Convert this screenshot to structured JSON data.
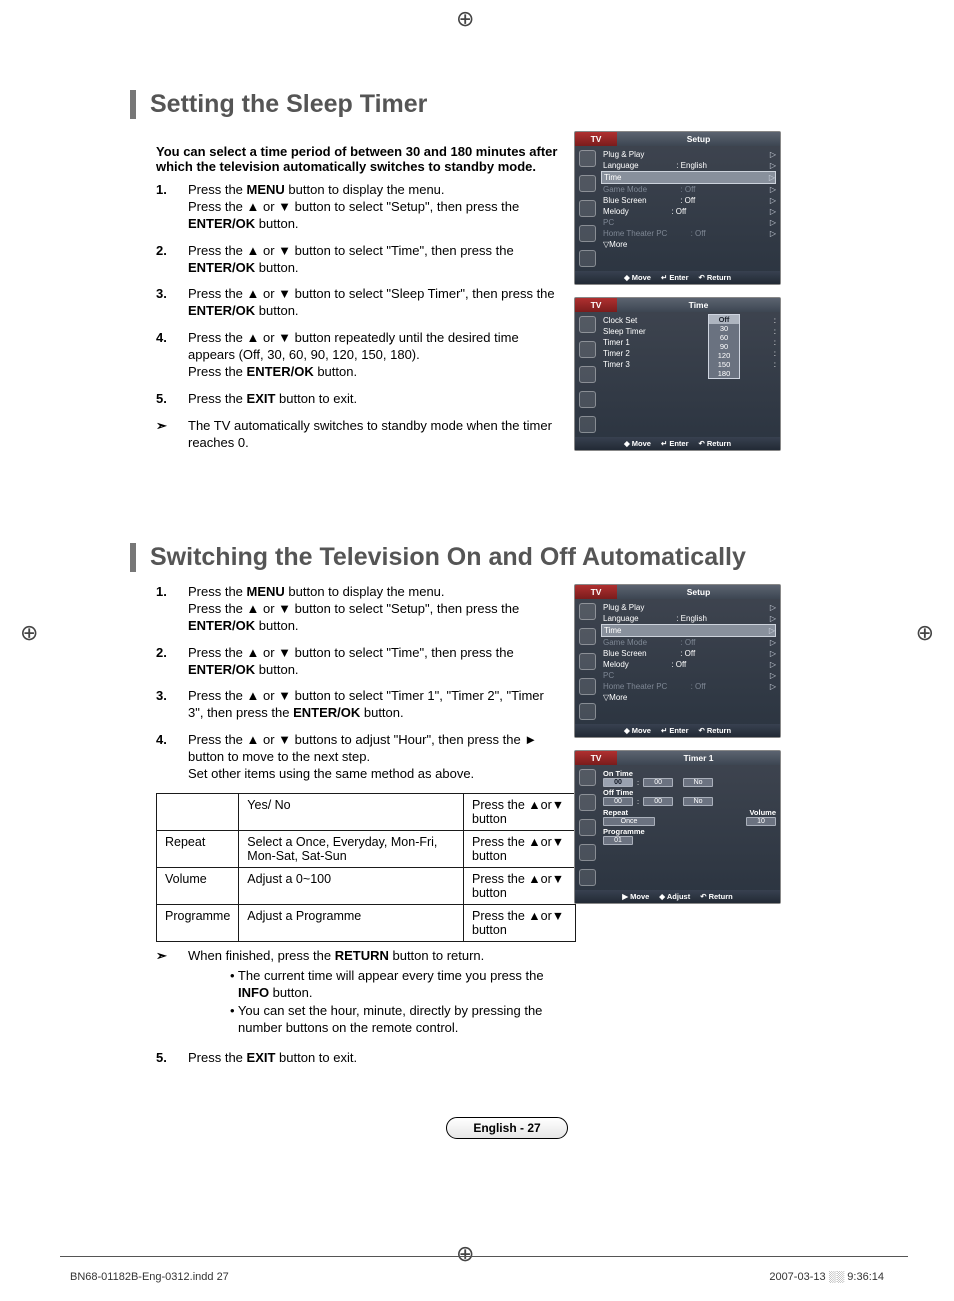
{
  "section1": {
    "title": "Setting the Sleep Timer",
    "intro": "You can select a time period of between 30 and 180 minutes after which the television automatically switches to standby mode.",
    "steps": [
      "Press the MENU button to display the menu.\nPress the ▲ or ▼ button to select \"Setup\", then press the ENTER/OK button.",
      "Press the ▲ or ▼ button to select \"Time\", then press the ENTER/OK button.",
      "Press the ▲ or ▼ button to select \"Sleep Timer\", then press the ENTER/OK button.",
      "Press the ▲ or ▼ button repeatedly until the desired time appears (Off, 30, 60, 90, 120, 150, 180).\nPress the ENTER/OK button.",
      "Press the EXIT button to exit."
    ],
    "note": "The TV automatically switches to standby mode when the timer reaches 0."
  },
  "section2": {
    "title": "Switching the Television On and Off Automatically",
    "steps": [
      "Press the MENU button to display the menu.\nPress the ▲ or ▼ button to select \"Setup\", then press the ENTER/OK button.",
      "Press the ▲ or ▼ button to select \"Time\", then press the ENTER/OK button.",
      "Press the ▲ or ▼ button to select \"Timer 1\", \"Timer 2\", \"Timer 3\", then press the ENTER/OK button.",
      "Press the ▲ or ▼ buttons to adjust \"Hour\", then press the ► button to move to the next step.\nSet other items using the same method as above."
    ],
    "table": {
      "rows": [
        [
          "",
          "Yes/ No",
          "Press the ▲or▼ button"
        ],
        [
          "Repeat",
          "Select a Once, Everyday, Mon-Fri, Mon-Sat, Sat-Sun",
          "Press the ▲or▼ button"
        ],
        [
          "Volume",
          "Adjust a 0~100",
          "Press the ▲or▼ button"
        ],
        [
          "Programme",
          "Adjust a Programme",
          "Press the ▲or▼ button"
        ]
      ]
    },
    "note": "When finished, press the RETURN button to return.",
    "bullets": [
      "The current time will appear every time you press the INFO button.",
      "You can set the hour, minute, directly by pressing the number buttons on the remote control."
    ],
    "step5": "Press the EXIT button to exit."
  },
  "osd": {
    "tv": "TV",
    "setup": "Setup",
    "time": "Time",
    "timer1": "Timer 1",
    "nav": {
      "move": "Move",
      "enter": "Enter",
      "return": "Return",
      "adjust": "Adjust"
    },
    "setupMenu": {
      "plugPlay": "Plug & Play",
      "language": "Language",
      "languageVal": ": English",
      "time": "Time",
      "gameMode": "Game Mode",
      "gameModeVal": ": Off",
      "blueScreen": "Blue Screen",
      "blueScreenVal": ": Off",
      "melody": "Melody",
      "melodyVal": ": Off",
      "pc": "PC",
      "homeTheater": "Home Theater PC",
      "homeTheaterVal": ": Off",
      "more": "▽More"
    },
    "timeMenu": {
      "clockSet": "Clock Set",
      "sleepTimer": "Sleep Timer",
      "timer1": "Timer 1",
      "timer2": "Timer 2",
      "timer3": "Timer 3",
      "opts": [
        "Off",
        "30",
        "60",
        "90",
        "120",
        "150",
        "180"
      ]
    },
    "timerPanel": {
      "onTime": "On Time",
      "offTime": "Off Time",
      "hour": "00",
      "colon": ":",
      "min": "00",
      "no": "No",
      "repeat": "Repeat",
      "volume": "Volume",
      "once": "Once",
      "vol": "10",
      "programme": "Programme",
      "prog": "01"
    }
  },
  "pageLabel": "English - 27",
  "footer": {
    "file": "BN68-01182B-Eng-0312.indd   27",
    "date": "2007-03-13   ░░ 9:36:14"
  }
}
